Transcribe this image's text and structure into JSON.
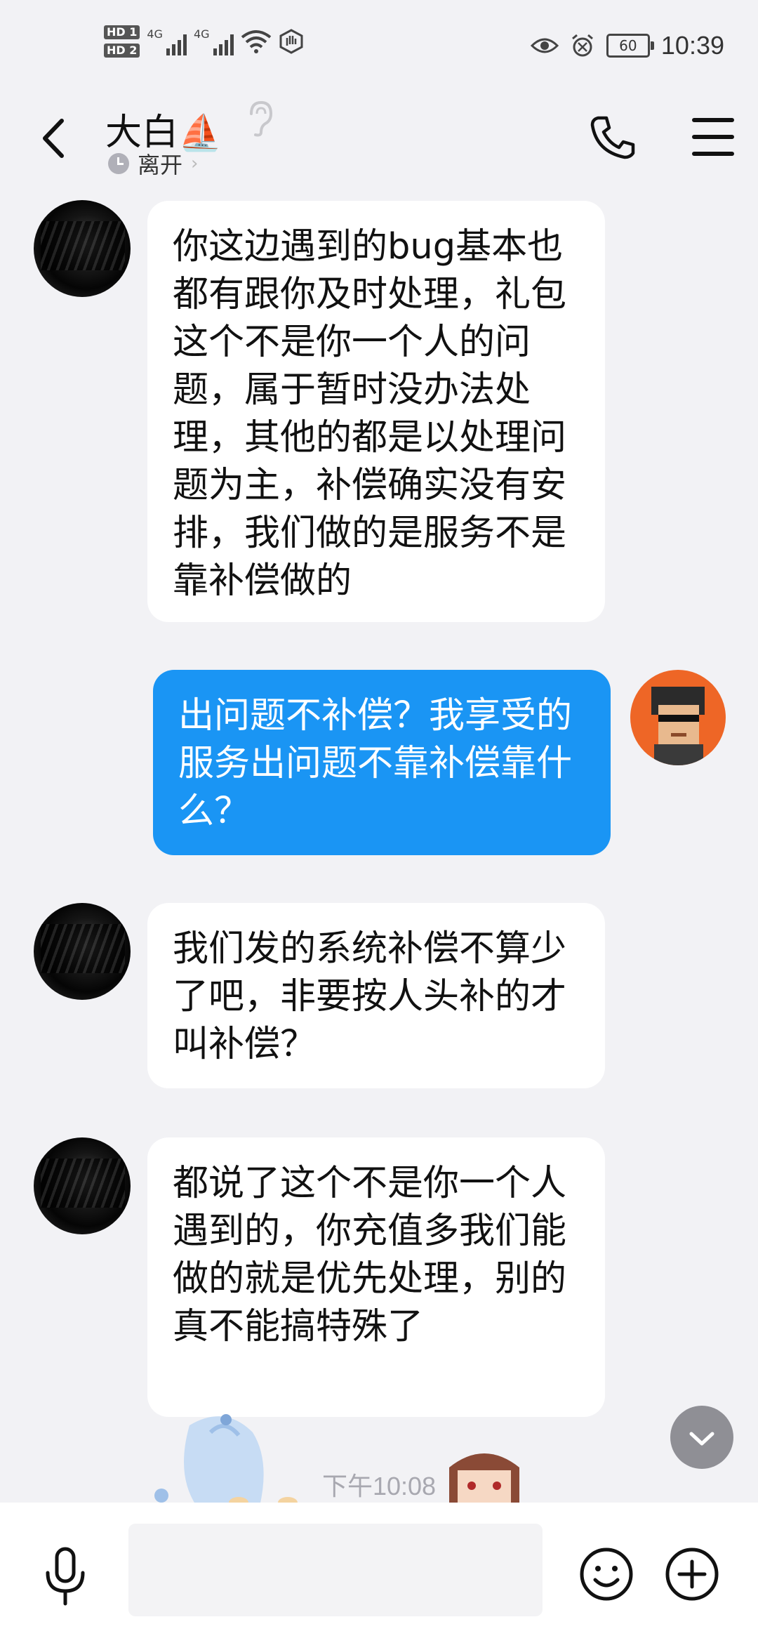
{
  "status_bar": {
    "hd1": "HD 1",
    "hd2": "HD 2",
    "network1": "4G",
    "network2": "4G",
    "battery": "60",
    "time": "10:39",
    "icons": [
      "wifi-icon",
      "hand-icon",
      "eye-icon",
      "alarm-icon",
      "battery-icon"
    ]
  },
  "header": {
    "title": "大白",
    "title_emoji": "⛵",
    "status": "离开",
    "icons": [
      "back-chevron-icon",
      "ear-icon",
      "phone-icon",
      "menu-icon"
    ]
  },
  "messages": [
    {
      "sender": "them",
      "text": "你这边遇到的bug基本也都有跟你及时处理，礼包这个不是你一个人的问题，属于暂时没办法处理，其他的都是以处理问题为主，补偿确实没有安排，我们做的是服务不是靠补偿做的"
    },
    {
      "sender": "me",
      "text": "出问题不补偿？我享受的服务出问题不靠补偿靠什么？"
    },
    {
      "sender": "them",
      "text": "我们发的系统补偿不算少了吧，非要按人头补的才叫补偿？"
    },
    {
      "sender": "them",
      "text": "都说了这个不是你一个人遇到的，你充值多我们能做的就是优先处理，别的真不能搞特殊了"
    }
  ],
  "timestamp": "下午10:08",
  "input_bar": {
    "icons": [
      "microphone-icon",
      "emoji-icon",
      "plus-icon"
    ],
    "text_value": ""
  },
  "colors": {
    "background": "#f2f2f5",
    "bubble_in": "#ffffff",
    "bubble_out": "#1a95f4",
    "my_avatar": "#ee6626"
  }
}
